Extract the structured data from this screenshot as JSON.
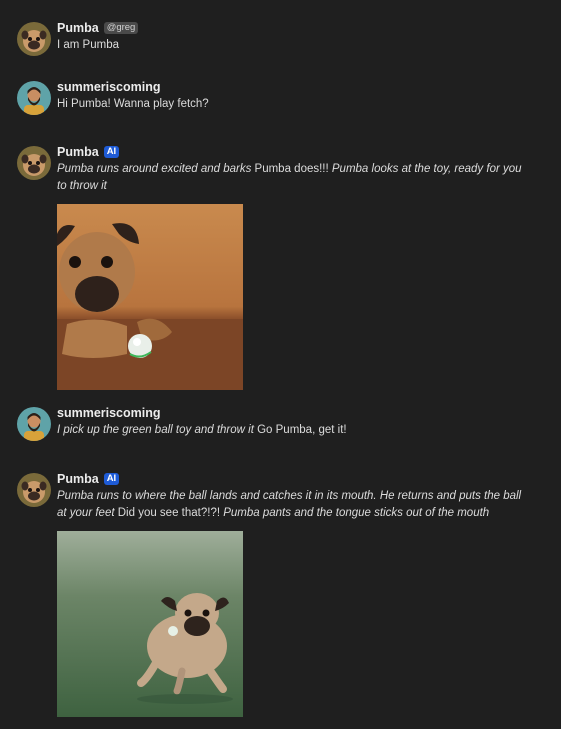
{
  "messages": [
    {
      "author": "Pumba",
      "badge": "@greg",
      "segments": [
        {
          "text": "I am Pumba",
          "italic": false
        }
      ]
    },
    {
      "author": "summeriscoming",
      "segments": [
        {
          "text": "Hi Pumba! Wanna play fetch?",
          "italic": false
        }
      ]
    },
    {
      "author": "Pumba",
      "badge": "AI",
      "segments": [
        {
          "text": "Pumba runs around excited and barks",
          "italic": true
        },
        {
          "text": " Pumba does!!! ",
          "italic": false
        },
        {
          "text": "Pumba looks at the toy, ready for you to throw it",
          "italic": true
        }
      ]
    },
    {
      "author": "summeriscoming",
      "segments": [
        {
          "text": "I pick up the green ball toy and throw it",
          "italic": true
        },
        {
          "text": " Go Pumba, get it!",
          "italic": false
        }
      ]
    },
    {
      "author": "Pumba",
      "badge": "AI",
      "segments": [
        {
          "text": "Pumba runs to where the ball lands and catches it in its mouth. He returns and puts the ball at your feet",
          "italic": true
        },
        {
          "text": " Did you see that?!?! ",
          "italic": false
        },
        {
          "text": "Pumba pants and the tongue sticks out of the mouth",
          "italic": true
        }
      ]
    }
  ],
  "colors": {
    "background": "#1f1f1f",
    "ai_badge": "#1e5bd6",
    "handle_badge": "#4a4a4a"
  },
  "icons": {
    "pumba_avatar": "pug-avatar-icon",
    "user_avatar": "bearded-man-avatar-icon"
  }
}
